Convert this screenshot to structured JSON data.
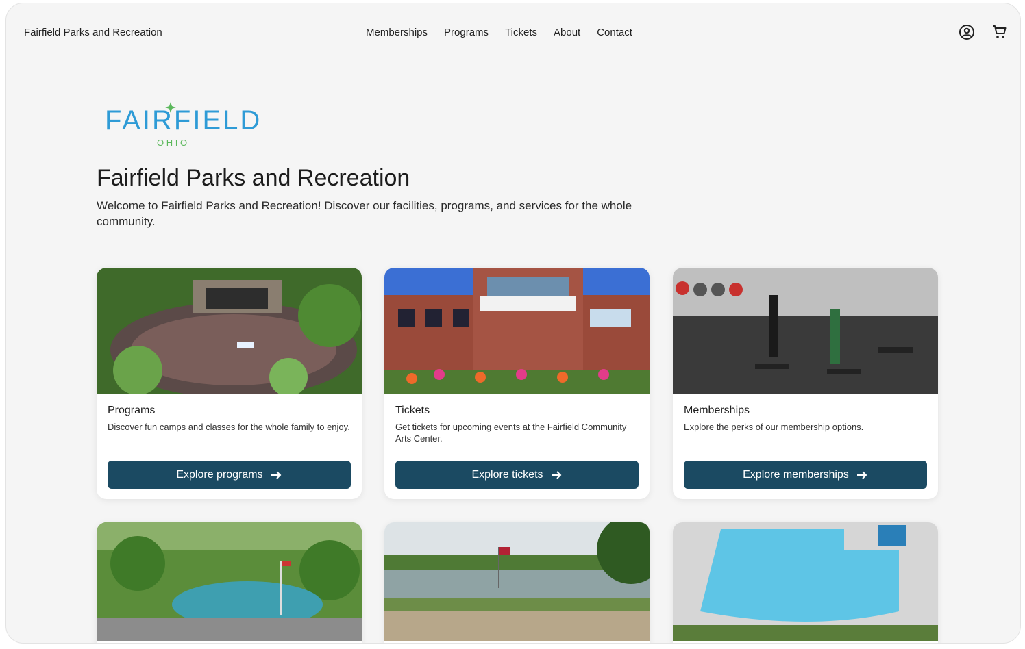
{
  "header": {
    "brand": "Fairfield Parks and Recreation",
    "menu": [
      "Memberships",
      "Programs",
      "Tickets",
      "About",
      "Contact"
    ],
    "icons": [
      "account-icon",
      "cart-icon"
    ]
  },
  "logo": {
    "word": "FAIRFIELD",
    "sub": "O H I O"
  },
  "hero": {
    "title": "Fairfield Parks and Recreation",
    "intro": "Welcome to Fairfield Parks and Recreation! Discover our facilities, programs, and services for the whole community."
  },
  "cards": [
    {
      "title": "Programs",
      "desc": "Discover fun camps and classes for the whole family to enjoy.",
      "button": "Explore programs"
    },
    {
      "title": "Tickets",
      "desc": "Get tickets for upcoming events at the Fairfield Community Arts Center.",
      "button": "Explore tickets"
    },
    {
      "title": "Memberships",
      "desc": "Explore the perks of our membership options.",
      "button": "Explore memberships"
    }
  ],
  "colors": {
    "accent": "#1b4a62",
    "logo_blue": "#2e9bd6",
    "logo_green": "#5cb85c"
  }
}
